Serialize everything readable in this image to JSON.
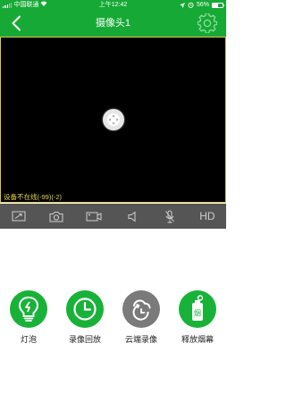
{
  "status_bar": {
    "carrier": "中国联通",
    "time": "上午12:42",
    "battery_text": "56%",
    "battery_level": 0.56
  },
  "header": {
    "title": "摄像头1",
    "back_icon": "chevron-left-icon",
    "settings_icon": "gear-icon"
  },
  "video": {
    "status_text": "设备不在线(-99)(-2)",
    "status_color": "#e8d44a",
    "border_color": "#d8c84a"
  },
  "toolbar": {
    "items": [
      {
        "icon": "fullscreen-icon"
      },
      {
        "icon": "camera-snapshot-icon"
      },
      {
        "icon": "record-video-icon"
      },
      {
        "icon": "speaker-icon"
      },
      {
        "icon": "microphone-muted-icon"
      },
      {
        "icon": "hd-quality",
        "label": "HD"
      }
    ]
  },
  "actions": [
    {
      "label": "灯泡",
      "icon": "lightbulb-icon",
      "color": "#18b238"
    },
    {
      "label": "录像回放",
      "icon": "clock-icon",
      "color": "#18b238"
    },
    {
      "label": "云端录像",
      "icon": "cloud-record-icon",
      "color": "#7a7a7a"
    },
    {
      "label": "释放烟幕",
      "icon": "smoke-canister-icon",
      "color": "#18b238"
    }
  ],
  "colors": {
    "brand_green": "#16a935",
    "toolbar_bg": "#555555"
  }
}
